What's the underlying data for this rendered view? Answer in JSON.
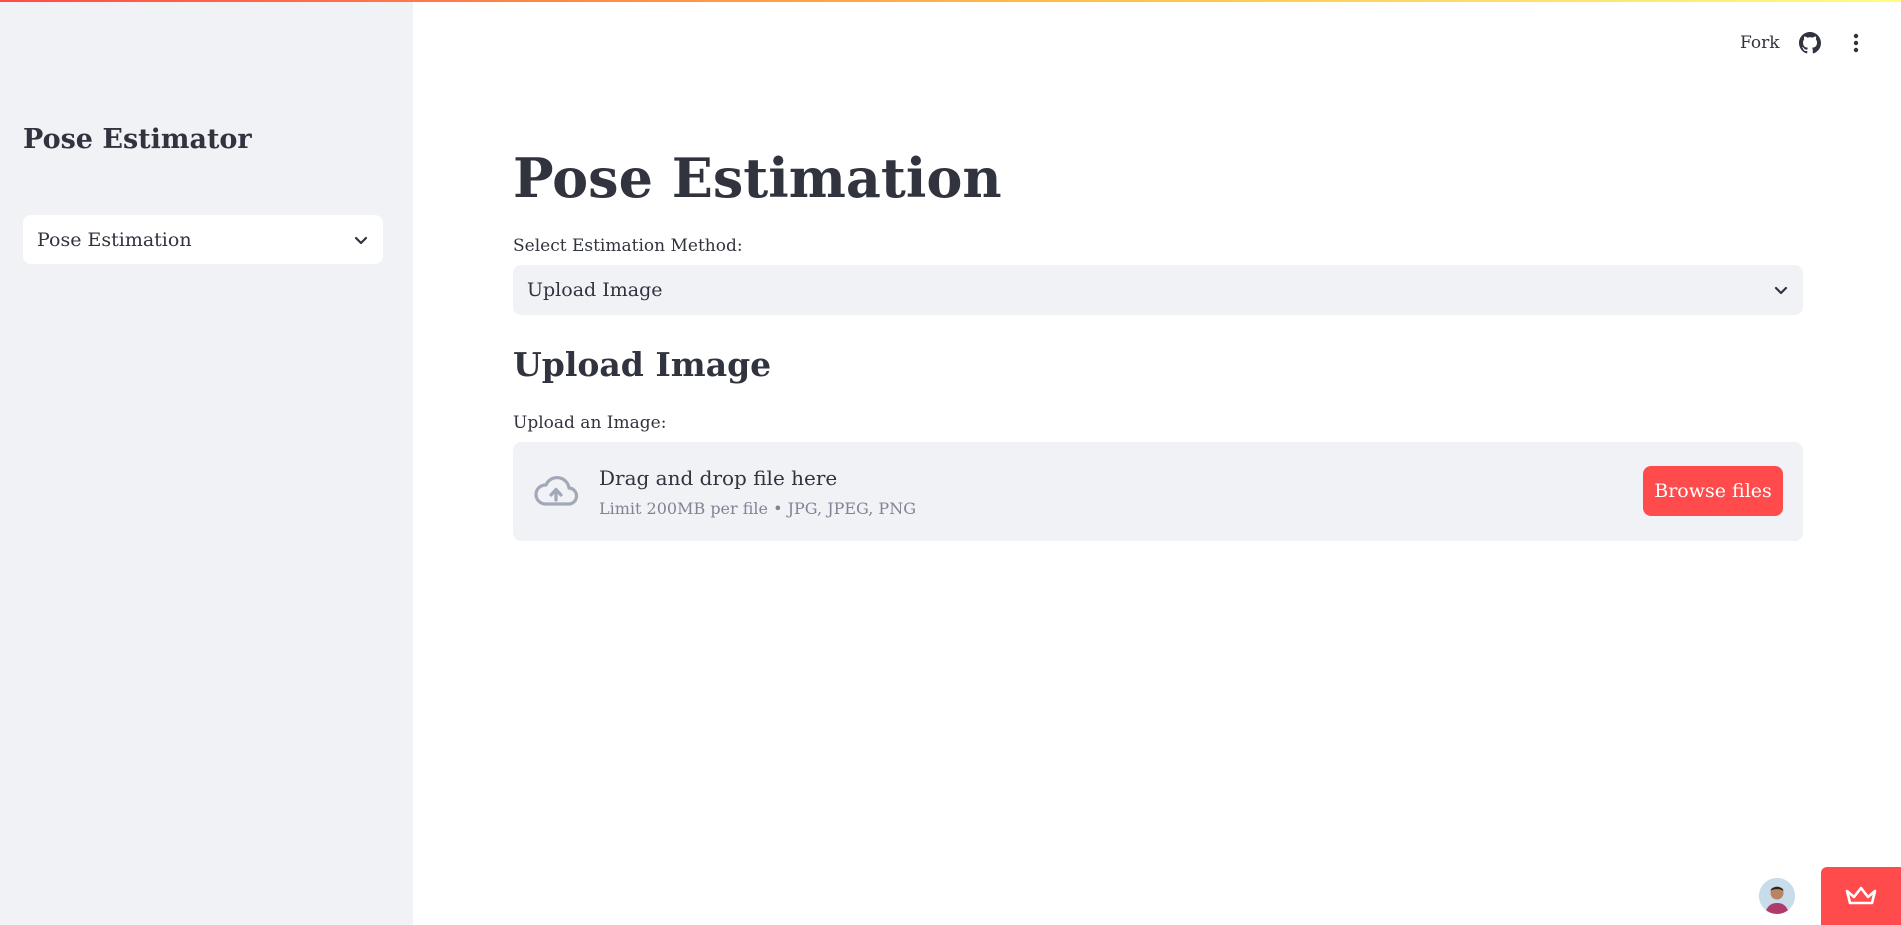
{
  "sidebar": {
    "title": "Pose Estimator",
    "select_value": "Pose Estimation"
  },
  "header": {
    "fork_label": "Fork",
    "github_icon": "github-icon",
    "menu_icon": "more-vertical-icon"
  },
  "main": {
    "title": "Pose Estimation",
    "method_label": "Select Estimation Method:",
    "method_value": "Upload Image",
    "section_title": "Upload Image",
    "upload_label": "Upload an Image:",
    "dropzone": {
      "primary_text": "Drag and drop file here",
      "limit_text": "Limit 200MB per file • JPG, JPEG, PNG",
      "icon": "cloud-upload-icon"
    },
    "browse_label": "Browse files"
  },
  "footer": {
    "avatar_icon": "avatar",
    "badge_icon": "crown-icon"
  },
  "colors": {
    "primary": "#ff4b4b",
    "sidebar_bg": "#f0f2f6",
    "text": "#31333f",
    "muted_text": "#808495"
  }
}
